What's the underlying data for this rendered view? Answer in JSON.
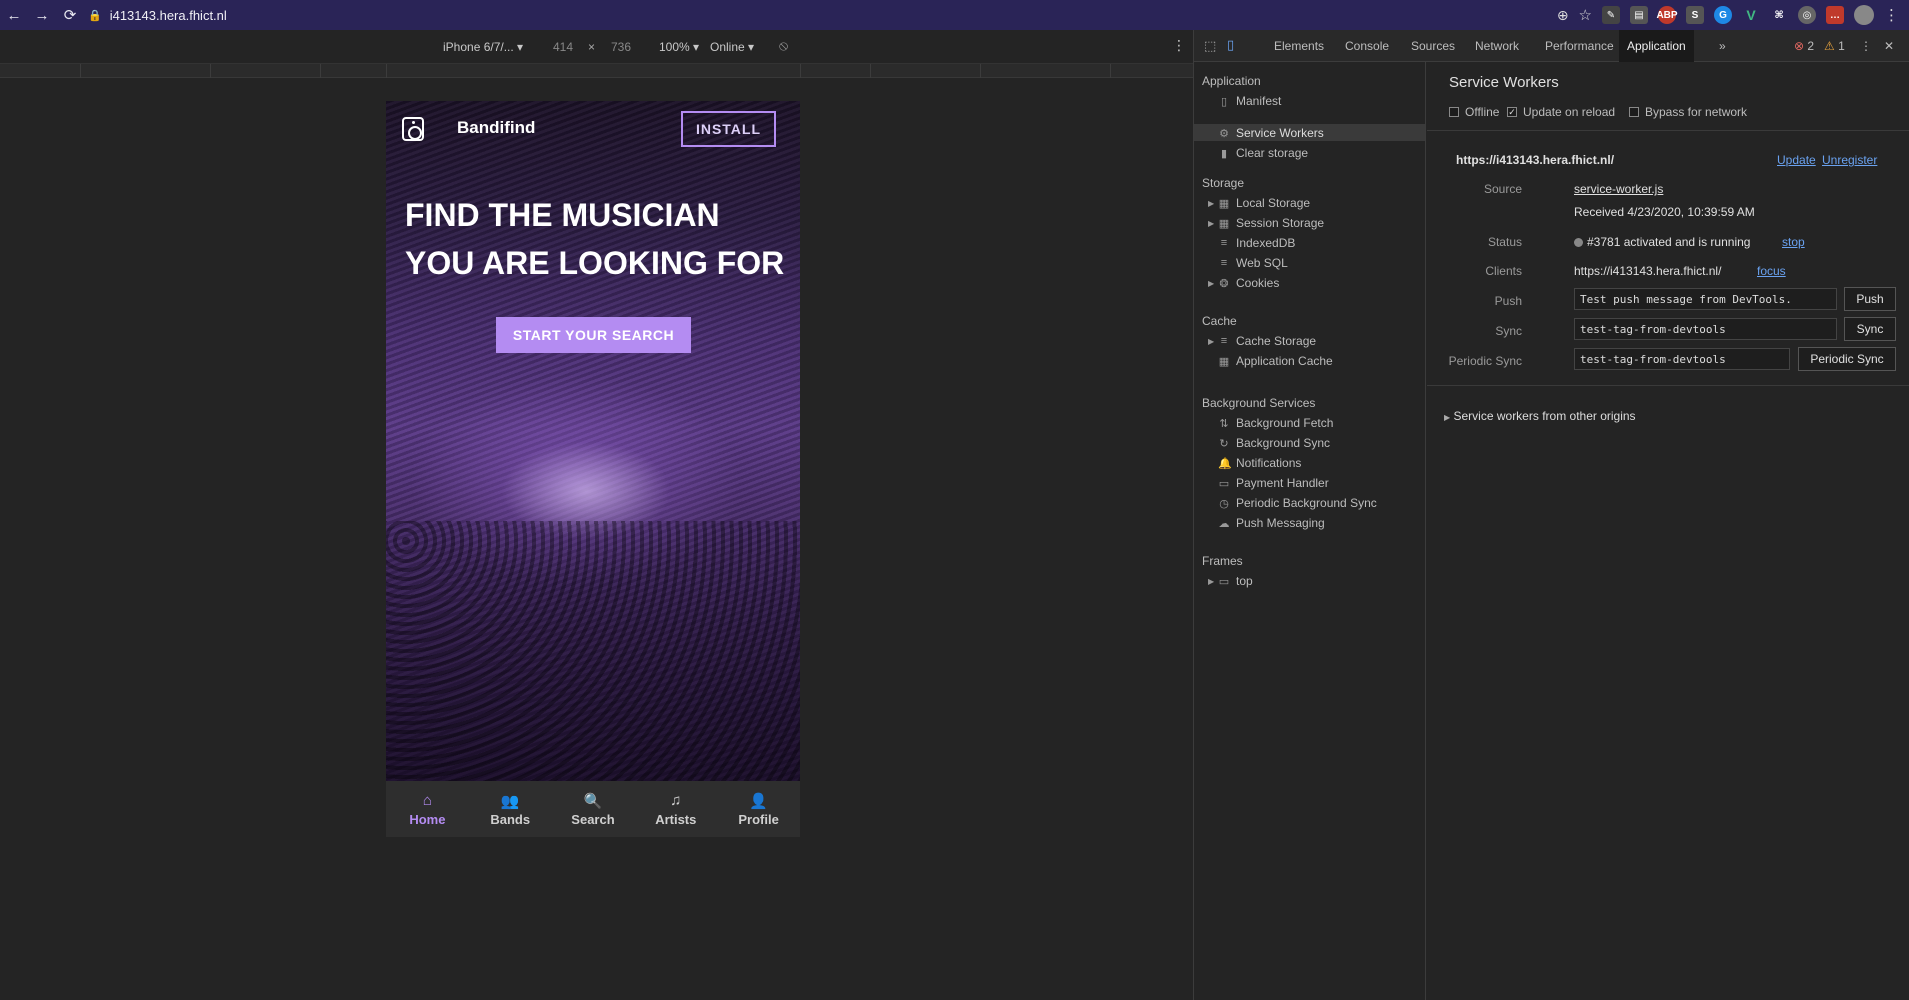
{
  "browser": {
    "url": "i413143.hera.fhict.nl",
    "nav": [
      "←",
      "→",
      "⟳"
    ]
  },
  "device_toolbar": {
    "device": "iPhone 6/7/...",
    "width": "414",
    "times": "×",
    "height": "736",
    "zoom": "100%",
    "network": "Online"
  },
  "app": {
    "brand": "Bandifind",
    "install": "INSTALL",
    "headline_line1": "FIND THE MUSICIAN",
    "headline_line2": "YOU ARE LOOKING FOR",
    "cta": "START YOUR SEARCH",
    "nav": [
      {
        "label": "Home",
        "icon": "home-icon"
      },
      {
        "label": "Bands",
        "icon": "group-icon"
      },
      {
        "label": "Search",
        "icon": "search-icon"
      },
      {
        "label": "Artists",
        "icon": "artist-icon"
      },
      {
        "label": "Profile",
        "icon": "person-icon"
      }
    ],
    "accent": "#b48cf2"
  },
  "devtools": {
    "tabs": [
      "Elements",
      "Console",
      "Sources",
      "Network",
      "Performance",
      "Application"
    ],
    "errors": "2",
    "warnings": "1",
    "sidebar": {
      "application_header": "Application",
      "application_items": [
        "Manifest",
        "Service Workers",
        "Clear storage"
      ],
      "storage_header": "Storage",
      "storage_items": [
        "Local Storage",
        "Session Storage",
        "IndexedDB",
        "Web SQL",
        "Cookies"
      ],
      "cache_header": "Cache",
      "cache_items": [
        "Cache Storage",
        "Application Cache"
      ],
      "bg_header": "Background Services",
      "bg_items": [
        "Background Fetch",
        "Background Sync",
        "Notifications",
        "Payment Handler",
        "Periodic Background Sync",
        "Push Messaging"
      ],
      "frames_header": "Frames",
      "frames_items": [
        "top"
      ]
    },
    "main": {
      "title": "Service Workers",
      "offline": "Offline",
      "update_on_reload": "Update on reload",
      "bypass": "Bypass for network",
      "origin": "https://i413143.hera.fhict.nl/",
      "update": "Update",
      "unregister": "Unregister",
      "source_label": "Source",
      "source_value": "service-worker.js",
      "received": "Received 4/23/2020, 10:39:59 AM",
      "status_label": "Status",
      "status_value": "#3781 activated and is running",
      "stop": "stop",
      "clients_label": "Clients",
      "clients_value": "https://i413143.hera.fhict.nl/",
      "focus": "focus",
      "push_label": "Push",
      "push_value": "Test push message from DevTools.",
      "push_btn": "Push",
      "sync_label": "Sync",
      "sync_value": "test-tag-from-devtools",
      "sync_btn": "Sync",
      "psync_label": "Periodic Sync",
      "psync_value": "test-tag-from-devtools",
      "psync_btn": "Periodic Sync",
      "other_origins": "Service workers from other origins"
    }
  }
}
